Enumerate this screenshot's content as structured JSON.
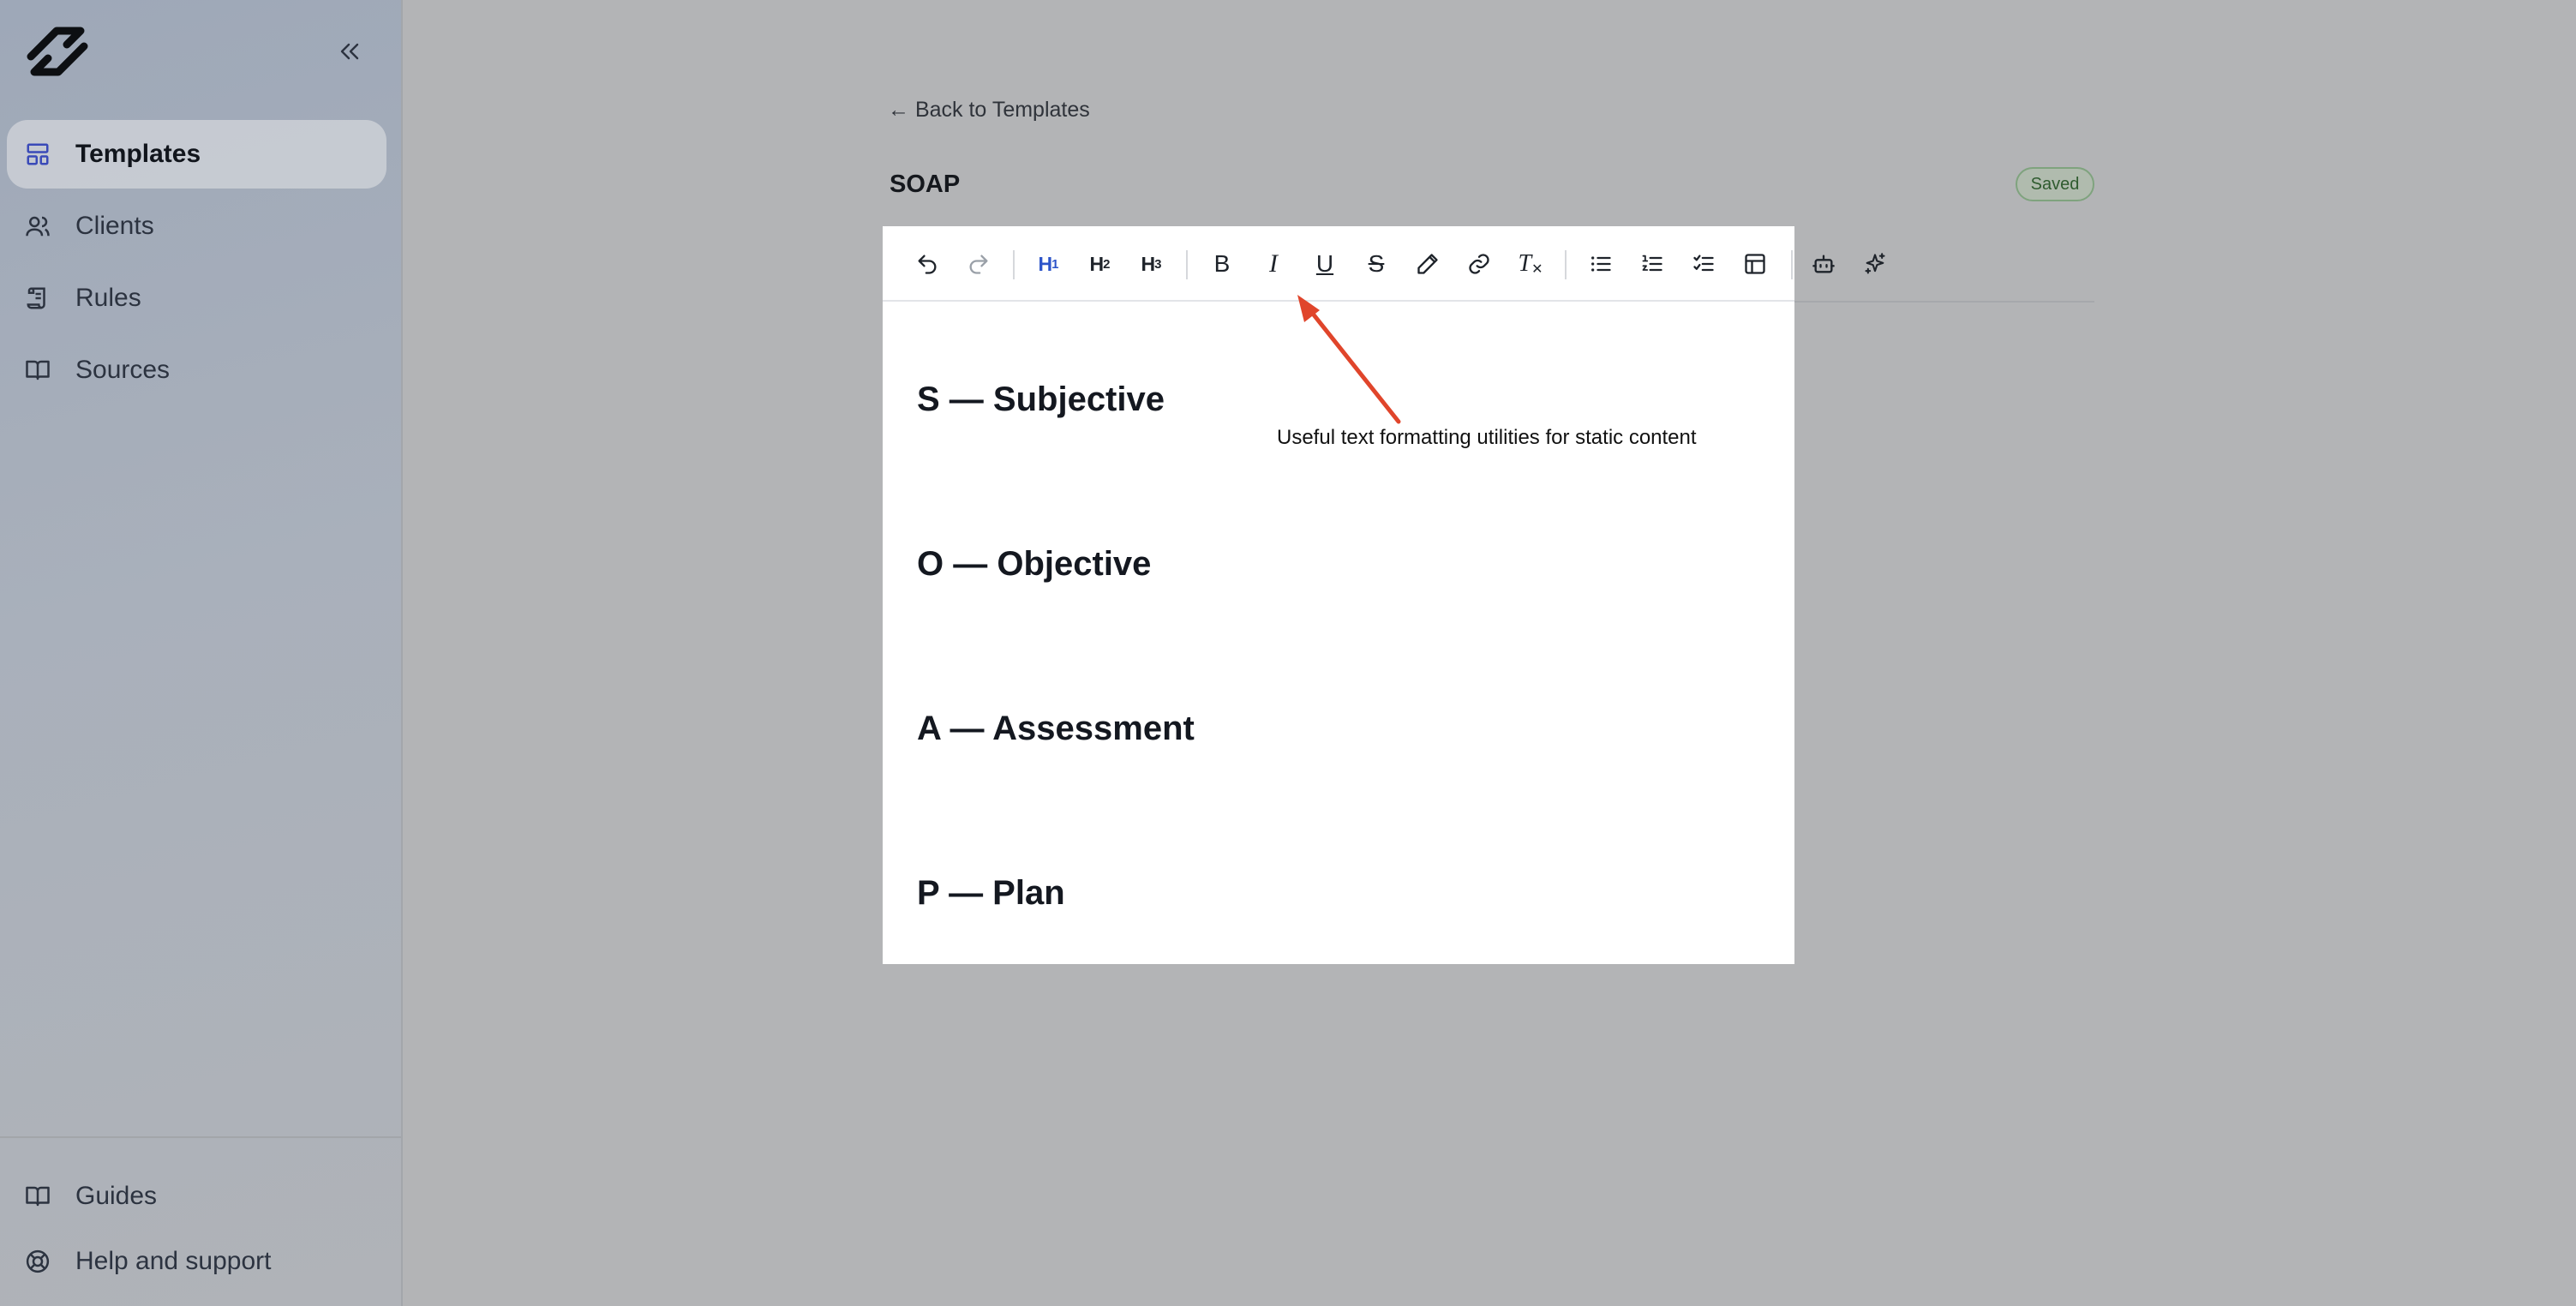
{
  "sidebar": {
    "nav": [
      {
        "label": "Templates",
        "icon": "layout-icon",
        "active": true
      },
      {
        "label": "Clients",
        "icon": "users-icon",
        "active": false
      },
      {
        "label": "Rules",
        "icon": "scroll-icon",
        "active": false
      },
      {
        "label": "Sources",
        "icon": "book-icon",
        "active": false
      }
    ],
    "bottom": [
      {
        "label": "Guides",
        "icon": "book-icon"
      },
      {
        "label": "Help and support",
        "icon": "lifebuoy-icon"
      }
    ]
  },
  "header": {
    "back_label": "← Back to Templates",
    "title": "SOAP",
    "status": "Saved"
  },
  "toolbar": {
    "h1": "H",
    "h1_sub": "1",
    "h2": "H",
    "h2_sub": "2",
    "h3": "H",
    "h3_sub": "3",
    "bold": "B",
    "italic": "I",
    "underline": "U",
    "strike": "S",
    "clear_format": "T"
  },
  "editor": {
    "headings": [
      "S — Subjective",
      "O — Objective",
      "A — Assessment",
      "P — Plan"
    ]
  },
  "annotation": {
    "text": "Useful text formatting utilities for static content",
    "color": "#e0452b"
  },
  "colors": {
    "accent": "#2d54c9",
    "saved_badge": "#7fa37e"
  }
}
